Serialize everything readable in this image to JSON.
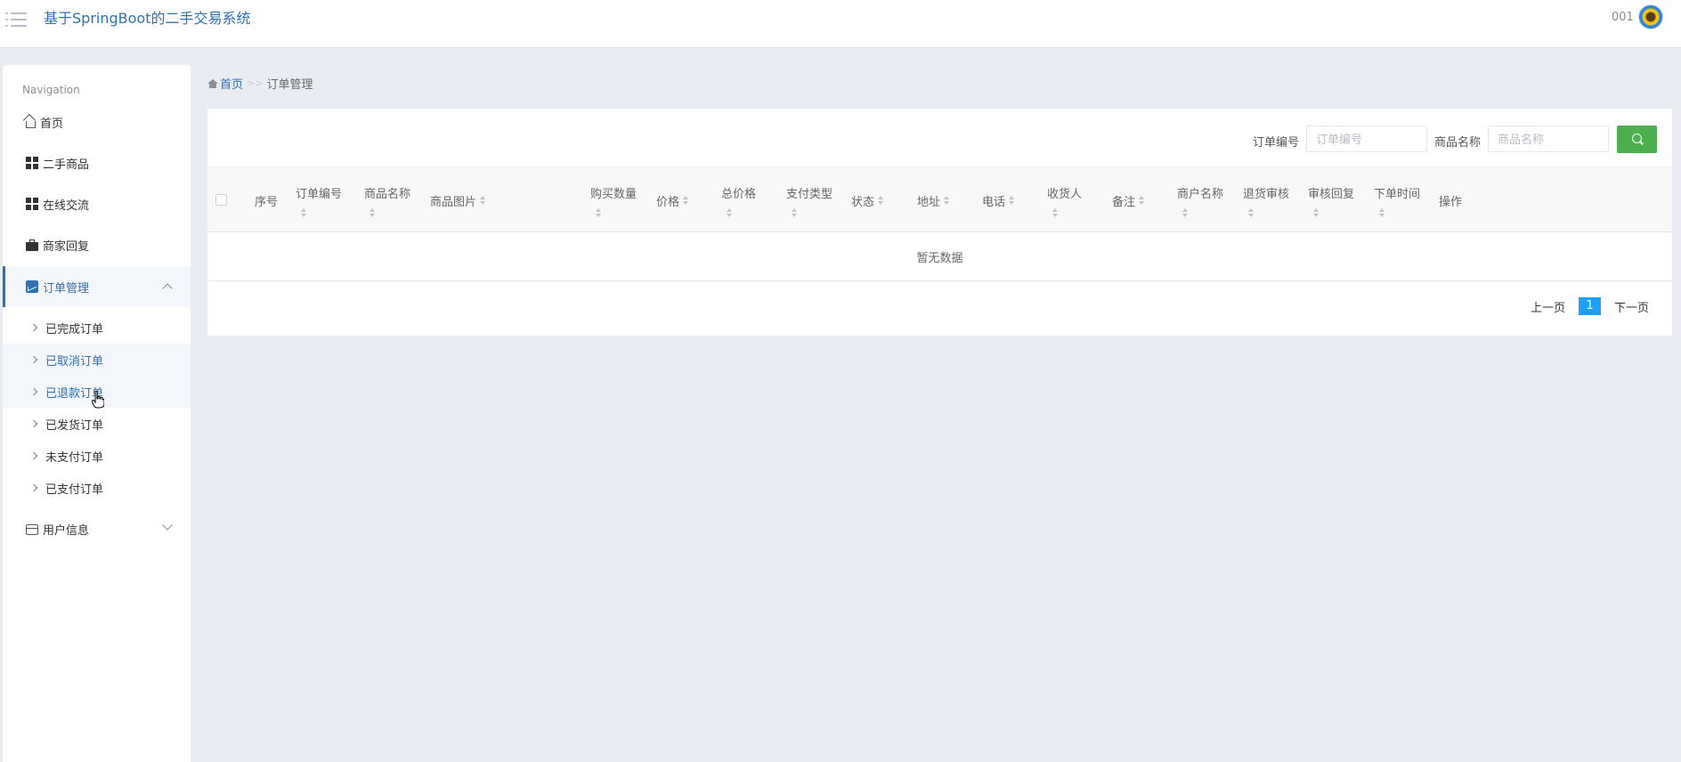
{
  "header": {
    "title": "基于SpringBoot的二手交易系统",
    "user": "001"
  },
  "sidebar": {
    "caption": "Navigation",
    "items": [
      {
        "label": "首页"
      },
      {
        "label": "二手商品"
      },
      {
        "label": "在线交流"
      },
      {
        "label": "商家回复"
      },
      {
        "label": "订单管理"
      },
      {
        "label": "用户信息"
      }
    ],
    "sub_items": [
      {
        "label": "已完成订单"
      },
      {
        "label": "已取消订单"
      },
      {
        "label": "已退款订单"
      },
      {
        "label": "已发货订单"
      },
      {
        "label": "未支付订单"
      },
      {
        "label": "已支付订单"
      }
    ]
  },
  "breadcrumb": {
    "home": "首页",
    "separator": ">>",
    "current": "订单管理"
  },
  "search": {
    "order_no_label": "订单编号",
    "order_no_placeholder": "订单编号",
    "goods_name_label": "商品名称",
    "goods_name_placeholder": "商品名称"
  },
  "table": {
    "columns": [
      "序号",
      "订单编号",
      "商品名称",
      "商品图片",
      "购买数量",
      "价格",
      "总价格",
      "支付类型",
      "状态",
      "地址",
      "电话",
      "收货人",
      "备注",
      "商户名称",
      "退货审核",
      "审核回复",
      "下单时间",
      "操作"
    ],
    "empty_text": "暂无数据"
  },
  "pagination": {
    "prev": "上一页",
    "current": "1",
    "next": "下一页"
  },
  "colors": {
    "primary": "#2f70b3",
    "search_button": "#4caf50",
    "page_active": "#1e9fff"
  }
}
